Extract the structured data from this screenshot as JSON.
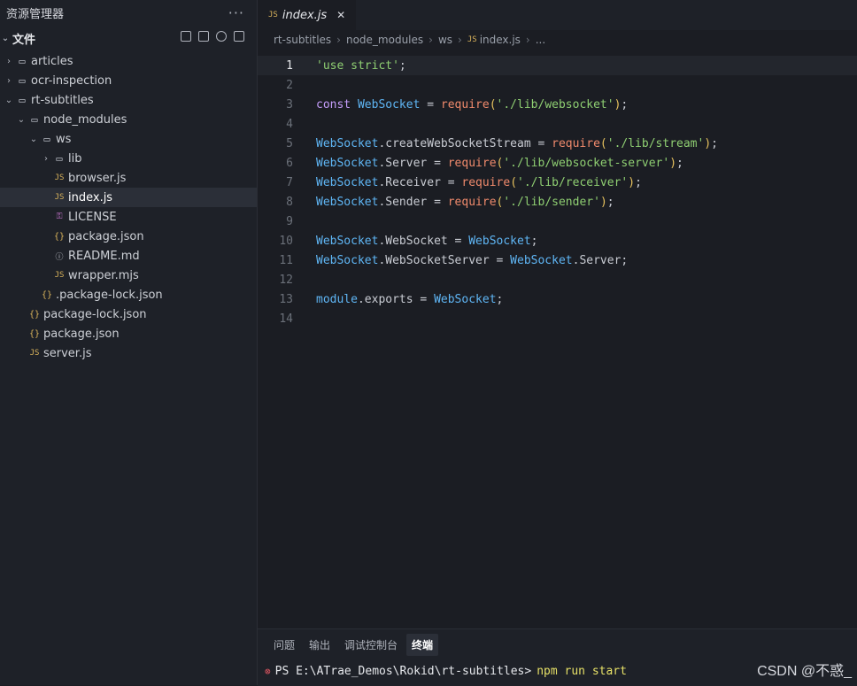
{
  "explorer": {
    "title": "资源管理器",
    "more": "···",
    "section_label": "文件",
    "tree": [
      {
        "label": "articles",
        "type": "folder",
        "depth": 0,
        "expanded": false
      },
      {
        "label": "ocr-inspection",
        "type": "folder",
        "depth": 0,
        "expanded": false
      },
      {
        "label": "rt-subtitles",
        "type": "folder",
        "depth": 0,
        "expanded": true
      },
      {
        "label": "node_modules",
        "type": "folder",
        "depth": 1,
        "expanded": true
      },
      {
        "label": "ws",
        "type": "folder",
        "depth": 2,
        "expanded": true
      },
      {
        "label": "lib",
        "type": "folder",
        "depth": 3,
        "expanded": false
      },
      {
        "label": "browser.js",
        "type": "js",
        "depth": 3
      },
      {
        "label": "index.js",
        "type": "js",
        "depth": 3,
        "active": true
      },
      {
        "label": "LICENSE",
        "type": "key",
        "depth": 3
      },
      {
        "label": "package.json",
        "type": "json",
        "depth": 3
      },
      {
        "label": "README.md",
        "type": "info",
        "depth": 3
      },
      {
        "label": "wrapper.mjs",
        "type": "js",
        "depth": 3
      },
      {
        "label": ".package-lock.json",
        "type": "json",
        "depth": 2
      },
      {
        "label": "package-lock.json",
        "type": "json",
        "depth": 1
      },
      {
        "label": "package.json",
        "type": "json",
        "depth": 1
      },
      {
        "label": "server.js",
        "type": "js",
        "depth": 1
      }
    ]
  },
  "tab": {
    "icon": "JS",
    "label": "index.js",
    "close": "✕"
  },
  "breadcrumb": [
    "rt-subtitles",
    "node_modules",
    "ws",
    "index.js",
    "..."
  ],
  "code": [
    {
      "n": "1",
      "current": true,
      "tokens": [
        [
          "str",
          "'use strict'"
        ],
        [
          "pl",
          ";"
        ]
      ]
    },
    {
      "n": "2",
      "tokens": []
    },
    {
      "n": "3",
      "tokens": [
        [
          "kw",
          "const "
        ],
        [
          "id",
          "WebSocket"
        ],
        [
          "op",
          " = "
        ],
        [
          "fn",
          "require"
        ],
        [
          "p",
          "("
        ],
        [
          "str",
          "'./lib/websocket'"
        ],
        [
          "p",
          ")"
        ],
        [
          "pl",
          ";"
        ]
      ]
    },
    {
      "n": "4",
      "tokens": []
    },
    {
      "n": "5",
      "tokens": [
        [
          "id",
          "WebSocket"
        ],
        [
          "pl",
          ".createWebSocketStream"
        ],
        [
          "op",
          " = "
        ],
        [
          "fn",
          "require"
        ],
        [
          "p",
          "("
        ],
        [
          "str",
          "'./lib/stream'"
        ],
        [
          "p",
          ")"
        ],
        [
          "pl",
          ";"
        ]
      ]
    },
    {
      "n": "6",
      "tokens": [
        [
          "id",
          "WebSocket"
        ],
        [
          "pl",
          ".Server"
        ],
        [
          "op",
          " = "
        ],
        [
          "fn",
          "require"
        ],
        [
          "p",
          "("
        ],
        [
          "str",
          "'./lib/websocket-server'"
        ],
        [
          "p",
          ")"
        ],
        [
          "pl",
          ";"
        ]
      ]
    },
    {
      "n": "7",
      "tokens": [
        [
          "id",
          "WebSocket"
        ],
        [
          "pl",
          ".Receiver"
        ],
        [
          "op",
          " = "
        ],
        [
          "fn",
          "require"
        ],
        [
          "p",
          "("
        ],
        [
          "str",
          "'./lib/receiver'"
        ],
        [
          "p",
          ")"
        ],
        [
          "pl",
          ";"
        ]
      ]
    },
    {
      "n": "8",
      "tokens": [
        [
          "id",
          "WebSocket"
        ],
        [
          "pl",
          ".Sender"
        ],
        [
          "op",
          " = "
        ],
        [
          "fn",
          "require"
        ],
        [
          "p",
          "("
        ],
        [
          "str",
          "'./lib/sender'"
        ],
        [
          "p",
          ")"
        ],
        [
          "pl",
          ";"
        ]
      ]
    },
    {
      "n": "9",
      "tokens": []
    },
    {
      "n": "10",
      "tokens": [
        [
          "id",
          "WebSocket"
        ],
        [
          "pl",
          ".WebSocket"
        ],
        [
          "op",
          " = "
        ],
        [
          "id",
          "WebSocket"
        ],
        [
          "pl",
          ";"
        ]
      ]
    },
    {
      "n": "11",
      "tokens": [
        [
          "id",
          "WebSocket"
        ],
        [
          "pl",
          ".WebSocketServer"
        ],
        [
          "op",
          " = "
        ],
        [
          "id",
          "WebSocket"
        ],
        [
          "pl",
          ".Server;"
        ]
      ]
    },
    {
      "n": "12",
      "tokens": []
    },
    {
      "n": "13",
      "tokens": [
        [
          "id",
          "module"
        ],
        [
          "pl",
          ".exports"
        ],
        [
          "op",
          " = "
        ],
        [
          "id",
          "WebSocket"
        ],
        [
          "pl",
          ";"
        ]
      ]
    },
    {
      "n": "14",
      "tokens": []
    }
  ],
  "panel": {
    "tabs": [
      "问题",
      "输出",
      "调试控制台",
      "终端"
    ],
    "active_tab": "终端",
    "terminal": {
      "prompt": "PS E:\\ATrae_Demos\\Rokid\\rt-subtitles>",
      "command": "npm run start"
    }
  },
  "watermark": "CSDN @不惑_",
  "colors": {
    "accent_js": "#d8b25b",
    "string": "#8fcf72",
    "keyword": "#c49dfa",
    "identifier": "#5fb6f5",
    "function": "#f08a6c"
  }
}
